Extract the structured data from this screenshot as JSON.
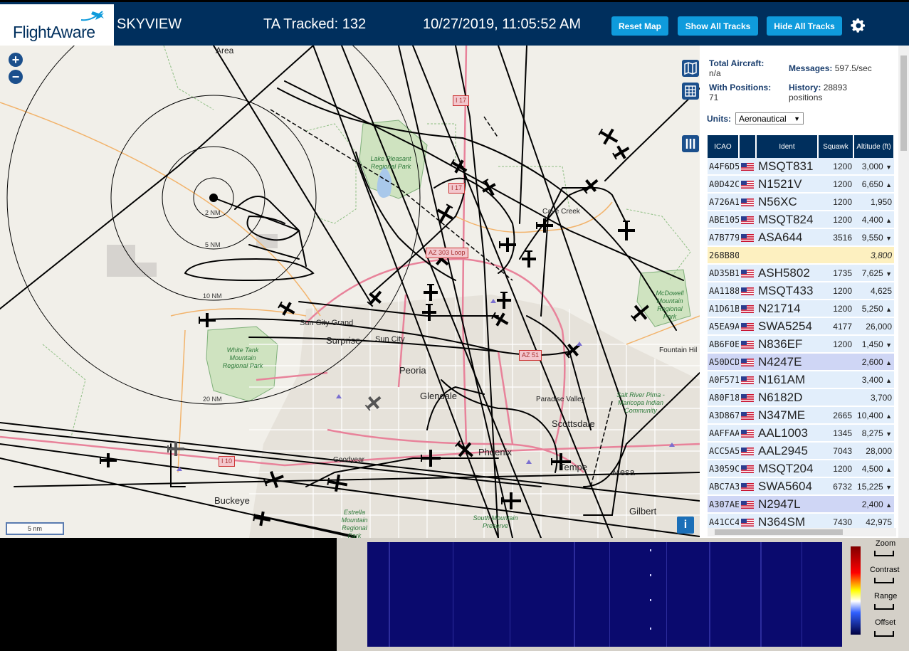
{
  "header": {
    "logo": "FlightAware",
    "title": "SKYVIEW",
    "tracked": "TA Tracked: 132",
    "datetime": "10/27/2019, 11:05:52 AM",
    "reset_map": "Reset Map",
    "show_all": "Show All Tracks",
    "hide_all": "Hide All Tracks"
  },
  "map": {
    "zoom_in": "+",
    "zoom_out": "−",
    "scale": "5 nm",
    "info": "i",
    "range_rings": [
      "2 NM",
      "5 NM",
      "10 NM",
      "20 NM"
    ],
    "cities": [
      "Sun City Grand",
      "Surprise",
      "Sun City",
      "Peoria",
      "Glendale",
      "Phoenix",
      "Scottsdale",
      "Paradise Valley",
      "Tempe",
      "Mesa",
      "Gilbert",
      "Goodyear",
      "Buckeye",
      "Cave Creek",
      "Fountain Hil",
      "Area"
    ],
    "parks": [
      "Lake Pleasant Regional Park",
      "White Tank Mountain Regional Park",
      "Estrella Mountain Regional Park",
      "South Mountain Preserve",
      "McDowell Mountain Regional Park",
      "Salt River Pima - Maricopa Indian Community"
    ],
    "highways": [
      "I 17",
      "I 17",
      "AZ 303 Loop",
      "AZ 51",
      "I 10"
    ]
  },
  "stats": {
    "total_label": "Total Aircraft:",
    "total_value": "n/a",
    "messages_label": "Messages:",
    "messages_value": "597.5/sec",
    "positions_label": "With Positions:",
    "positions_value": "71",
    "history_label": "History:",
    "history_value": "28893",
    "history_unit": "positions",
    "units_label": "Units:",
    "units_value": "Aeronautical"
  },
  "table": {
    "headers": [
      "ICAO",
      "",
      "Ident",
      "Squawk",
      "Altitude (ft)"
    ],
    "rows": [
      {
        "icao": "A4F6D5",
        "flag": true,
        "ident": "MSQT831",
        "squawk": "1200",
        "alt": "3,000",
        "trend": "▼",
        "style": ""
      },
      {
        "icao": "A0D42C",
        "flag": true,
        "ident": "N1521V",
        "squawk": "1200",
        "alt": "6,650",
        "trend": "▲",
        "style": ""
      },
      {
        "icao": "A726A1",
        "flag": true,
        "ident": "N56XC",
        "squawk": "1200",
        "alt": "1,950",
        "trend": "",
        "style": ""
      },
      {
        "icao": "ABE105",
        "flag": true,
        "ident": "MSQT824",
        "squawk": "1200",
        "alt": "4,400",
        "trend": "▲",
        "style": ""
      },
      {
        "icao": "A7B779",
        "flag": true,
        "ident": "ASA644",
        "squawk": "3516",
        "alt": "9,550",
        "trend": "▼",
        "style": ""
      },
      {
        "icao": "268B80",
        "flag": false,
        "ident": "",
        "squawk": "",
        "alt": "3,800",
        "trend": "",
        "style": "hl"
      },
      {
        "icao": "AD35B1",
        "flag": true,
        "ident": "ASH5802",
        "squawk": "1735",
        "alt": "7,625",
        "trend": "▼",
        "style": ""
      },
      {
        "icao": "AA1188",
        "flag": true,
        "ident": "MSQT433",
        "squawk": "1200",
        "alt": "4,625",
        "trend": "",
        "style": ""
      },
      {
        "icao": "A1D61B",
        "flag": true,
        "ident": "N21714",
        "squawk": "1200",
        "alt": "5,250",
        "trend": "▲",
        "style": ""
      },
      {
        "icao": "A5EA9A",
        "flag": true,
        "ident": "SWA5254",
        "squawk": "4177",
        "alt": "26,000",
        "trend": "",
        "style": ""
      },
      {
        "icao": "AB6F0E",
        "flag": true,
        "ident": "N836EF",
        "squawk": "1200",
        "alt": "1,450",
        "trend": "▼",
        "style": ""
      },
      {
        "icao": "A50DCD",
        "flag": true,
        "ident": "N4247E",
        "squawk": "",
        "alt": "2,600",
        "trend": "▲",
        "style": "sel"
      },
      {
        "icao": "A0F571",
        "flag": true,
        "ident": "N161AM",
        "squawk": "",
        "alt": "3,400",
        "trend": "▲",
        "style": ""
      },
      {
        "icao": "A80F18",
        "flag": true,
        "ident": "N6182D",
        "squawk": "",
        "alt": "3,700",
        "trend": "",
        "style": ""
      },
      {
        "icao": "A3D867",
        "flag": true,
        "ident": "N347ME",
        "squawk": "2665",
        "alt": "10,400",
        "trend": "▲",
        "style": ""
      },
      {
        "icao": "AAFFAA",
        "flag": true,
        "ident": "AAL1003",
        "squawk": "1345",
        "alt": "8,275",
        "trend": "▼",
        "style": ""
      },
      {
        "icao": "ACC5A5",
        "flag": true,
        "ident": "AAL2945",
        "squawk": "7043",
        "alt": "28,000",
        "trend": "",
        "style": ""
      },
      {
        "icao": "A3059C",
        "flag": true,
        "ident": "MSQT204",
        "squawk": "1200",
        "alt": "4,500",
        "trend": "▲",
        "style": ""
      },
      {
        "icao": "ABC7A3",
        "flag": true,
        "ident": "SWA5604",
        "squawk": "6732",
        "alt": "15,225",
        "trend": "▼",
        "style": ""
      },
      {
        "icao": "A307AE",
        "flag": true,
        "ident": "N2947L",
        "squawk": "",
        "alt": "2,400",
        "trend": "▲",
        "style": "sel"
      },
      {
        "icao": "A41CC4",
        "flag": true,
        "ident": "N364SM",
        "squawk": "7430",
        "alt": "42,975",
        "trend": "",
        "style": ""
      }
    ]
  },
  "spectrum": {
    "zoom": "Zoom",
    "contrast": "Contrast",
    "range": "Range",
    "offset": "Offset"
  },
  "colors": {
    "header_bg": "#002f5d",
    "button": "#0f9bdc",
    "track": "#000000",
    "waterfall": "#0a0a6e"
  }
}
